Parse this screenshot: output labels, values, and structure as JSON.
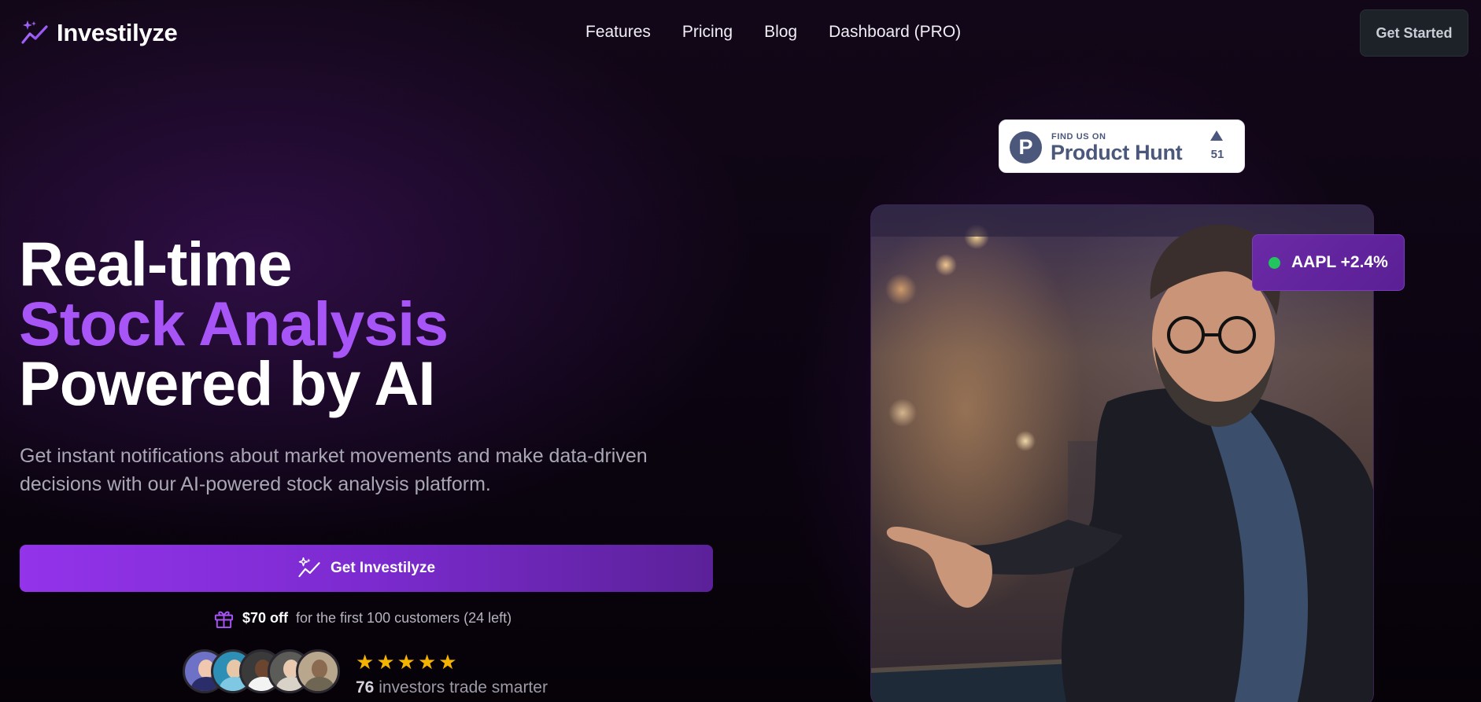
{
  "nav": {
    "brand": "Investilyze",
    "links": [
      "Features",
      "Pricing",
      "Blog",
      "Dashboard (PRO)"
    ],
    "cta": "Get Started"
  },
  "hero": {
    "headline_line1": "Real-time",
    "headline_accent": "Stock Analysis",
    "headline_line3": "Powered by AI",
    "subtext": "Get instant notifications about market movements and make data-driven decisions with our AI-powered stock analysis platform.",
    "cta_label": "Get Investilyze",
    "offer_amount": "$70 off",
    "offer_rest": "for the first 100 customers (24 left)",
    "rating_stars": 5,
    "investor_count": "76",
    "investor_text": "investors trade smarter"
  },
  "product_hunt": {
    "small": "FIND US ON",
    "big": "Product Hunt",
    "logo_letter": "P",
    "upvotes": "51"
  },
  "ticker": {
    "text": "AAPL +2.4%",
    "status_color": "#22c55e"
  },
  "colors": {
    "accent": "#a855f7",
    "cta_start": "#9333ea",
    "star": "#f5b301"
  },
  "icons": [
    "sparkle-chart-icon",
    "gift-icon",
    "star-icon",
    "upvote-arrow-icon"
  ]
}
